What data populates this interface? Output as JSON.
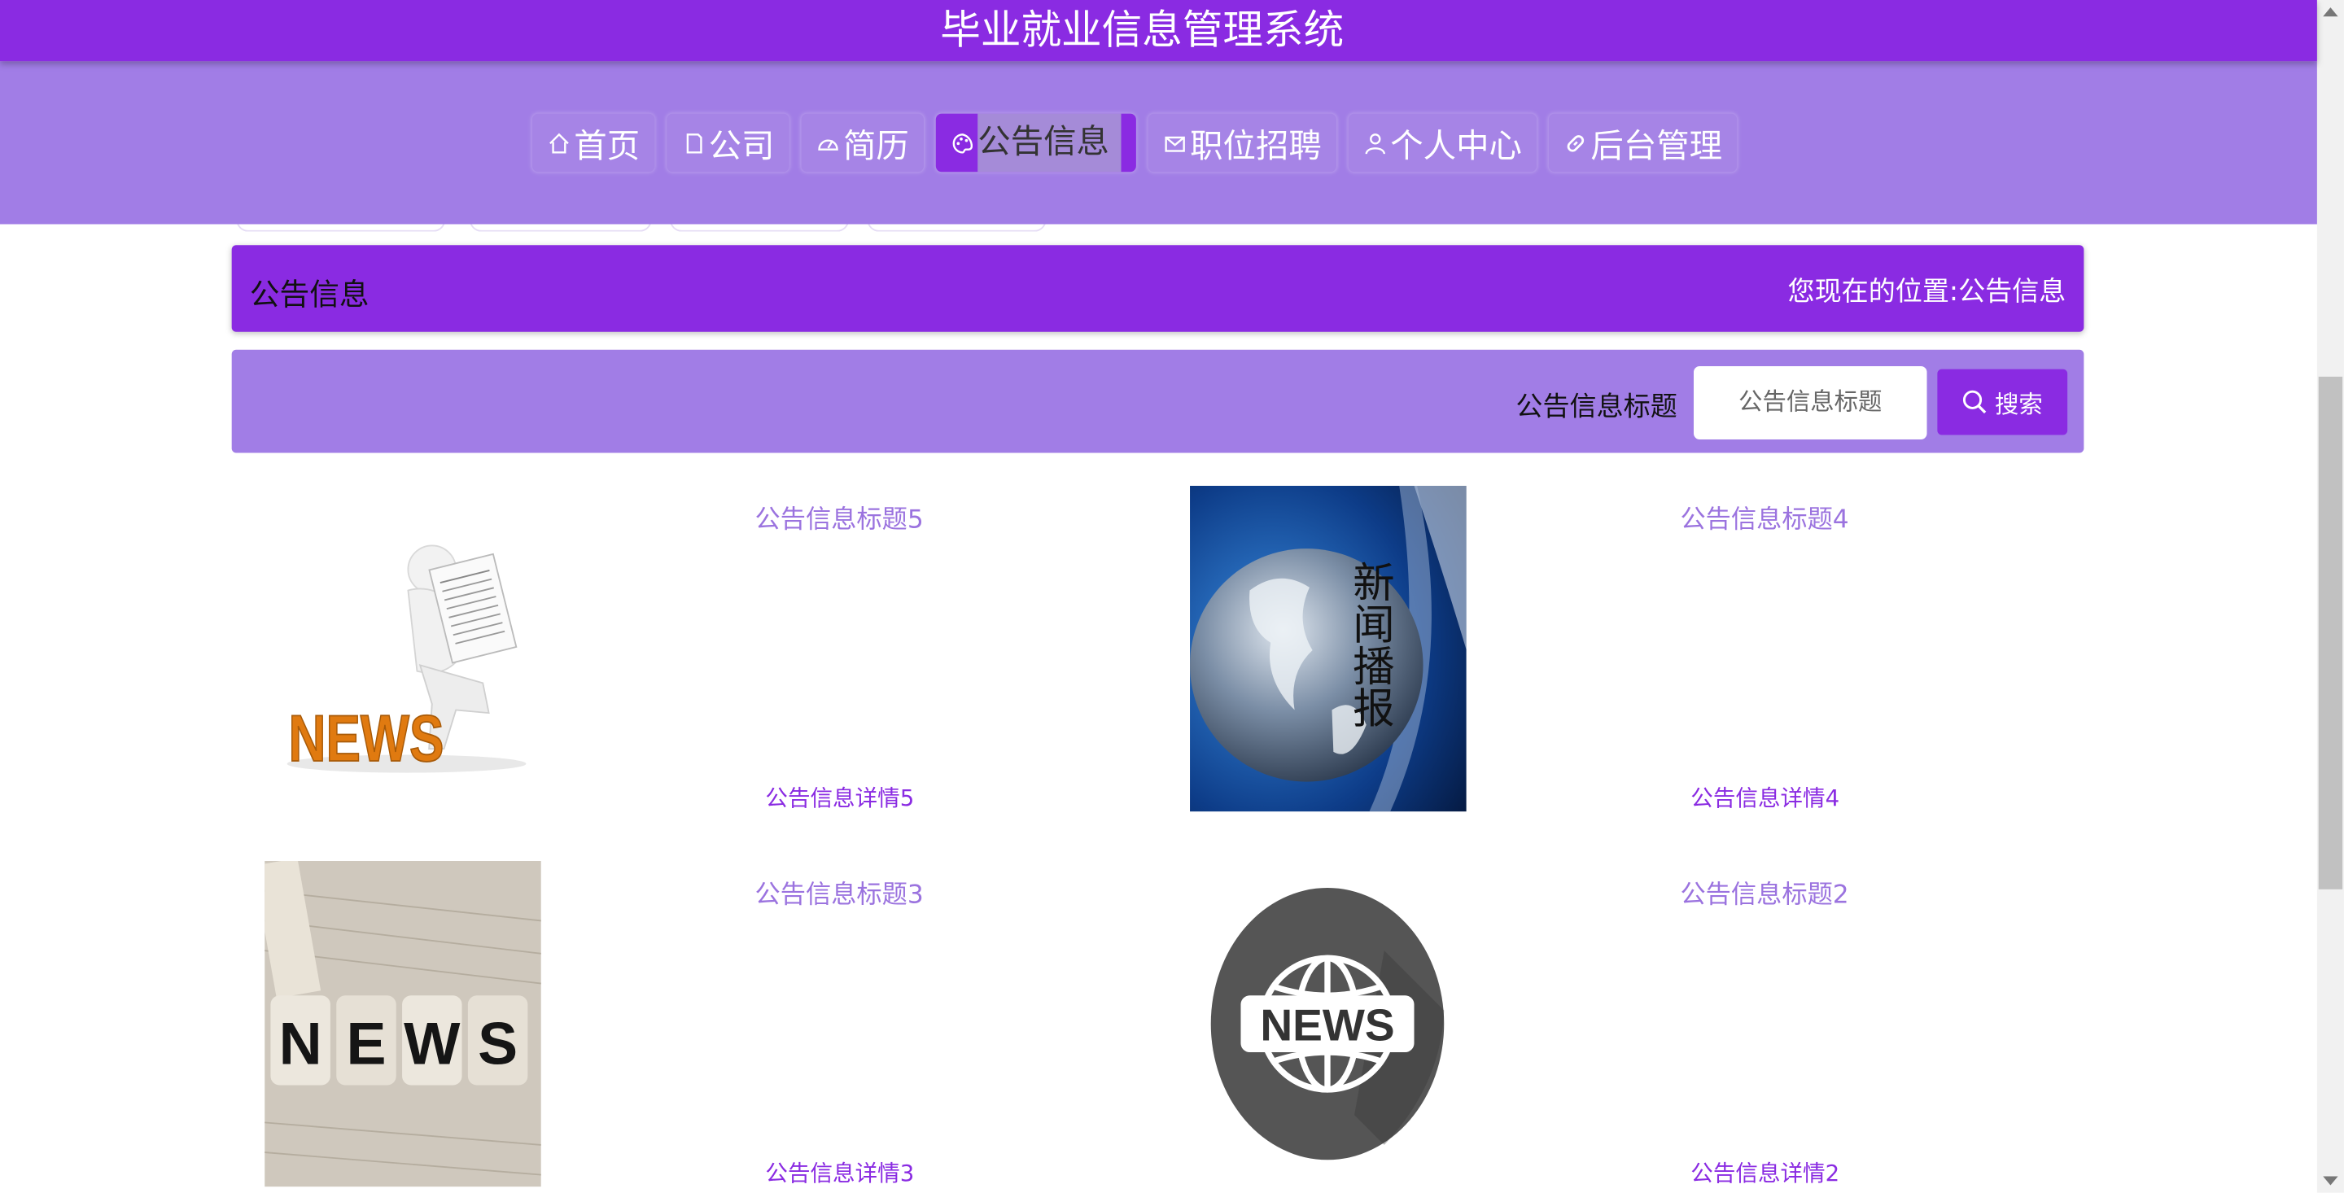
{
  "site": {
    "title": "毕业就业信息管理系统"
  },
  "nav": {
    "items": [
      {
        "label": "首页",
        "icon": "home-icon"
      },
      {
        "label": "公司",
        "icon": "document-icon"
      },
      {
        "label": "简历",
        "icon": "gauge-icon"
      },
      {
        "label": "公告信息",
        "icon": "palette-icon"
      },
      {
        "label": "职位招聘",
        "icon": "mail-icon"
      },
      {
        "label": "个人中心",
        "icon": "user-icon"
      },
      {
        "label": "后台管理",
        "icon": "link-icon"
      }
    ],
    "active": "公告信息"
  },
  "breadcrumb": {
    "title": "公告信息",
    "position_prefix": "您现在的位置:",
    "position_current": "公告信息"
  },
  "search": {
    "label": "公告信息标题",
    "placeholder": "公告信息标题",
    "button_label": "搜索"
  },
  "news": [
    {
      "title": "公告信息标题5",
      "detail": "公告信息详情5",
      "image": "news-figure-reading-image"
    },
    {
      "title": "公告信息标题4",
      "detail": "公告信息详情4",
      "image": "globe-news-broadcast-image"
    },
    {
      "title": "公告信息标题3",
      "detail": "公告信息详情3",
      "image": "news-dice-image"
    },
    {
      "title": "公告信息标题2",
      "detail": "公告信息详情2",
      "image": "news-globe-badge-image"
    }
  ],
  "images": {
    "broadcast_text": "新闻播报",
    "news_word": "NEWS",
    "dice_letters": [
      "N",
      "E",
      "W",
      "S"
    ]
  },
  "colors": {
    "primary": "#8a2be2",
    "secondary": "#a17de6"
  }
}
